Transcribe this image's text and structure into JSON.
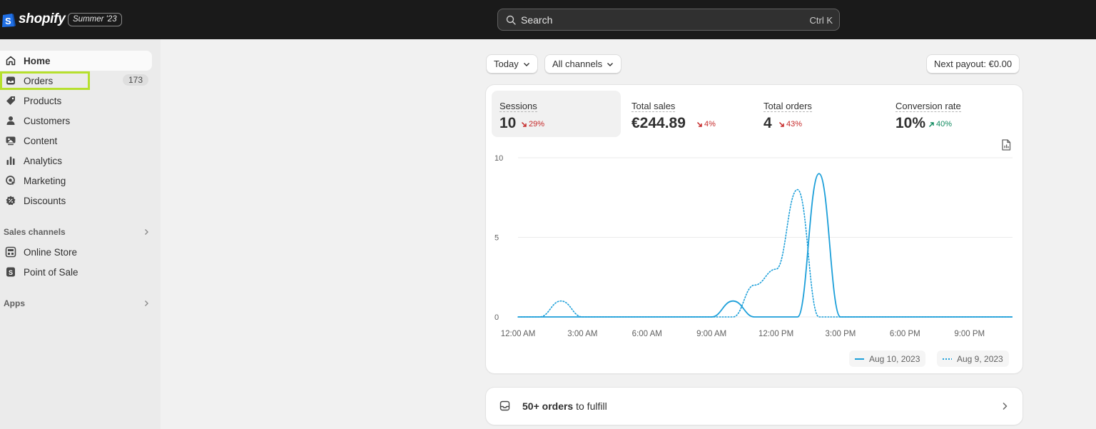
{
  "topbar": {
    "logo_text": "shopify",
    "edition_badge": "Summer '23",
    "search_placeholder": "Search",
    "search_shortcut": "Ctrl K"
  },
  "sidebar": {
    "items": [
      {
        "label": "Home",
        "icon": "home-icon",
        "active": true
      },
      {
        "label": "Orders",
        "icon": "inbox-icon",
        "count": "173"
      },
      {
        "label": "Products",
        "icon": "tag-icon"
      },
      {
        "label": "Customers",
        "icon": "person-icon"
      },
      {
        "label": "Content",
        "icon": "image-icon"
      },
      {
        "label": "Analytics",
        "icon": "bar-chart-icon"
      },
      {
        "label": "Marketing",
        "icon": "target-icon"
      },
      {
        "label": "Discounts",
        "icon": "discount-icon"
      }
    ],
    "sales_channels_label": "Sales channels",
    "channels": [
      {
        "label": "Online Store",
        "icon": "store-icon"
      },
      {
        "label": "Point of Sale",
        "icon": "pos-icon"
      }
    ],
    "apps_label": "Apps"
  },
  "filters": {
    "date": "Today",
    "channels": "All channels",
    "payout": "Next payout: €0.00"
  },
  "metrics": [
    {
      "label": "Sessions",
      "value": "10",
      "change": "29%",
      "direction": "down"
    },
    {
      "label": "Total sales",
      "value": "€244.89",
      "change": "4%",
      "direction": "down"
    },
    {
      "label": "Total orders",
      "value": "4",
      "change": "43%",
      "direction": "down"
    },
    {
      "label": "Conversion rate",
      "value": "10%",
      "change": "40%",
      "direction": "up"
    }
  ],
  "chart_data": {
    "type": "line",
    "x_tick_labels": [
      "12:00 AM",
      "3:00 AM",
      "6:00 AM",
      "9:00 AM",
      "12:00 PM",
      "3:00 PM",
      "6:00 PM",
      "9:00 PM"
    ],
    "y_tick_labels": [
      "0",
      "5",
      "10"
    ],
    "ylim": [
      0,
      10
    ],
    "xlim": [
      0,
      23
    ],
    "grid": true,
    "legend_placement": "bottom-right",
    "series": [
      {
        "name": "Aug 10, 2023",
        "style": "solid",
        "color": "#1c9fd9",
        "x": [
          0,
          9,
          10,
          11,
          12,
          13,
          14,
          15,
          16,
          23
        ],
        "y": [
          0,
          0,
          1,
          0,
          0,
          0,
          9,
          0,
          0,
          0
        ]
      },
      {
        "name": "Aug 9, 2023",
        "style": "dotted",
        "color": "#1c9fd9",
        "x": [
          0,
          1,
          2,
          3,
          9,
          10,
          11,
          12,
          13,
          14,
          15,
          23
        ],
        "y": [
          0,
          0,
          1,
          0,
          0,
          0,
          2,
          3,
          8,
          0,
          0,
          0
        ]
      }
    ]
  },
  "orders_card": {
    "count_text": "50+ orders",
    "suffix_text": "to fulfill"
  }
}
